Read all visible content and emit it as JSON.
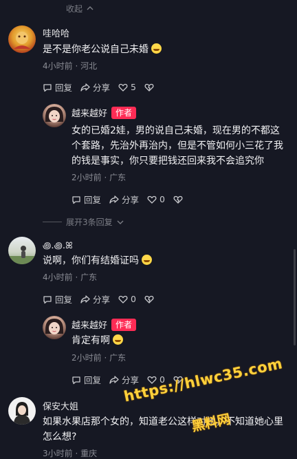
{
  "collapse_label": "收起",
  "comments": [
    {
      "username": "哇哈哈",
      "text": "是不是你老公说自己未婚",
      "time": "4小时前",
      "location": "河北",
      "reply_label": "回复",
      "share_label": "分享",
      "likes": "5"
    },
    {
      "username": "越来越好",
      "badge": "作者",
      "text_lines": [
        "女的已婚2娃，男的说自己未婚，现在男的不都这",
        "个套路，先治外再治内，但是不管如何小三花了我",
        "的钱是事实，你只要把钱还回来我不会追究你"
      ],
      "time": "2小时前",
      "location": "广东",
      "reply_label": "回复",
      "share_label": "分享",
      "likes": "0"
    },
    {
      "username": "꩜.꩜.ꕤ",
      "text": "说啊，你们有结婚证吗",
      "time": "4小时前",
      "location": "广东",
      "reply_label": "回复",
      "share_label": "分享",
      "likes": "0"
    },
    {
      "username": "越来越好",
      "badge": "作者",
      "text": "肯定有啊",
      "time": "2小时前",
      "location": "广东",
      "reply_label": "回复",
      "share_label": "分享",
      "likes": "0"
    },
    {
      "username": "保安大姐",
      "text_lines": [
        "如果水果店那个女的，知道老公这样对她，不知道她心里",
        "怎么想?"
      ],
      "time": "3小时前",
      "location": "重庆"
    }
  ],
  "expand_label": "展开3条回复",
  "watermark": {
    "url": "https://hlwc35.com",
    "name": "黑料网"
  },
  "colors": {
    "background": "#161823",
    "badge": "#fe2c55",
    "watermark": "#ffd13b"
  }
}
